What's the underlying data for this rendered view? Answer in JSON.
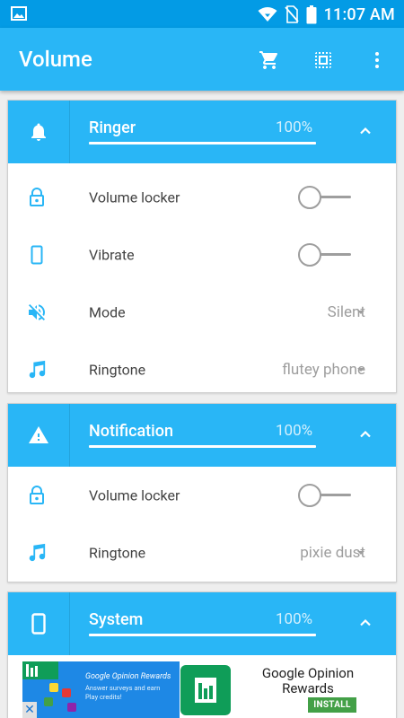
{
  "statusbar": {
    "time": "11:07 AM"
  },
  "appbar": {
    "title": "Volume",
    "actions": [
      "cart-icon",
      "select-all-icon",
      "more-vert-icon"
    ]
  },
  "colors": {
    "primary": "#29b6f6",
    "primary_dark": "#039be5",
    "text": "#424242",
    "muted": "#9e9e9e",
    "ad_install": "#43a047"
  },
  "cards": [
    {
      "name": "Ringer",
      "percent": "100%",
      "level": 1.0,
      "icon": "bell-icon",
      "rows": [
        {
          "icon": "lock-icon",
          "label": "Volume locker",
          "control": "toggle",
          "on": false
        },
        {
          "icon": "vibrate-icon",
          "label": "Vibrate",
          "control": "toggle",
          "on": false
        },
        {
          "icon": "volume-off-icon",
          "label": "Mode",
          "control": "dropdown",
          "value": "Silent"
        },
        {
          "icon": "music-note-icon",
          "label": "Ringtone",
          "control": "dropdown",
          "value": "flutey phone"
        }
      ]
    },
    {
      "name": "Notification",
      "percent": "100%",
      "level": 1.0,
      "icon": "warning-icon",
      "rows": [
        {
          "icon": "lock-icon",
          "label": "Volume locker",
          "control": "toggle",
          "on": false
        },
        {
          "icon": "music-note-icon",
          "label": "Ringtone",
          "control": "dropdown",
          "value": "pixie dust"
        }
      ]
    },
    {
      "name": "System",
      "percent": "100%",
      "level": 1.0,
      "icon": "phone-icon",
      "rows": []
    }
  ],
  "ad": {
    "banner_title": "Google Opinion Rewards",
    "banner_text": "Answer surveys and earn Play credits!",
    "title": "Google Opinion Rewards",
    "install": "INSTALL",
    "close": "✕"
  }
}
